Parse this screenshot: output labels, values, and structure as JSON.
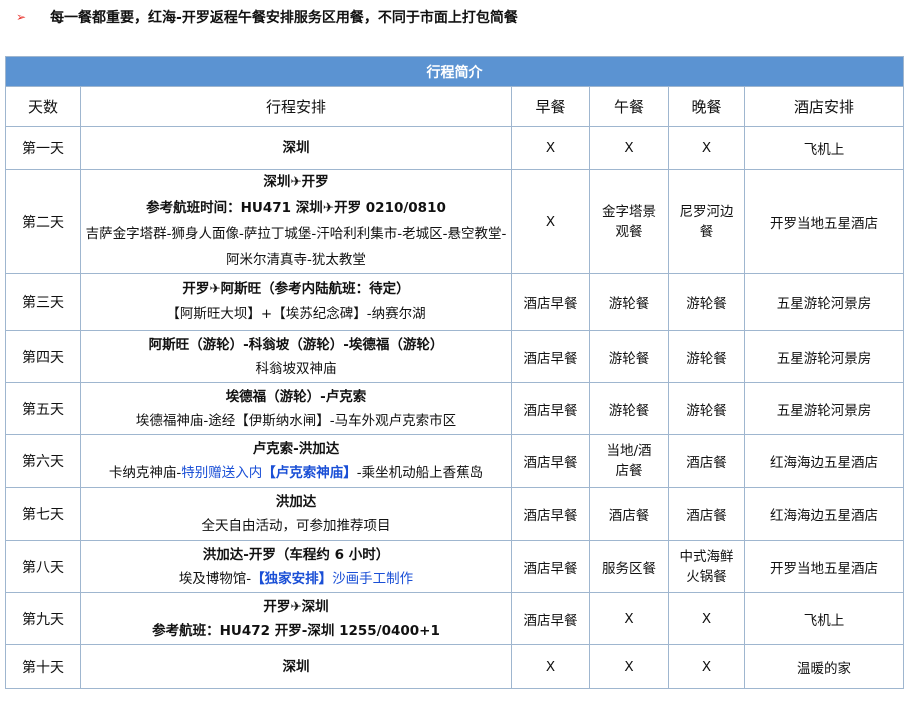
{
  "note": {
    "bullet": "➢",
    "text": "每一餐都重要，红海-开罗返程午餐安排服务区用餐，不同于市面上打包简餐"
  },
  "table": {
    "title": "行程简介",
    "headers": {
      "day": "天数",
      "schedule": "行程安排",
      "breakfast": "早餐",
      "lunch": "午餐",
      "dinner": "晚餐",
      "hotel": "酒店安排"
    },
    "rows": [
      {
        "day": "第一天",
        "title": "深圳",
        "ref": "",
        "detail_a": "",
        "detail_hl": "",
        "detail_b": "",
        "breakfast": "X",
        "lunch": "X",
        "dinner": "X",
        "hotel": "飞机上"
      },
      {
        "day": "第二天",
        "title": "深圳✈开罗",
        "ref": "参考航班时间：HU471 深圳✈开罗   0210/0810",
        "detail_a": "吉萨金字塔群-狮身人面像-萨拉丁城堡-汗哈利利集市-老城区-悬空教堂-阿米尔清真寺-犹太教堂",
        "detail_hl": "",
        "detail_b": "",
        "breakfast": "X",
        "lunch": "金字塔景观餐",
        "dinner": "尼罗河边餐",
        "hotel": "开罗当地五星酒店"
      },
      {
        "day": "第三天",
        "title": "开罗✈阿斯旺（参考内陆航班：待定）",
        "ref": "",
        "detail_a": "【阿斯旺大坝】+【埃苏纪念碑】-纳赛尔湖",
        "detail_hl": "",
        "detail_b": "",
        "breakfast": "酒店早餐",
        "lunch": "游轮餐",
        "dinner": "游轮餐",
        "hotel": "五星游轮河景房"
      },
      {
        "day": "第四天",
        "title": "阿斯旺（游轮）-科翁坡（游轮）-埃德福（游轮）",
        "ref": "",
        "detail_a": "科翁坡双神庙",
        "detail_hl": "",
        "detail_b": "",
        "breakfast": "酒店早餐",
        "lunch": "游轮餐",
        "dinner": "游轮餐",
        "hotel": "五星游轮河景房"
      },
      {
        "day": "第五天",
        "title": "埃德福（游轮）-卢克索",
        "ref": "",
        "detail_a": "埃德福神庙-途经【伊斯纳水闸】-马车外观卢克索市区",
        "detail_hl": "",
        "detail_b": "",
        "breakfast": "酒店早餐",
        "lunch": "游轮餐",
        "dinner": "游轮餐",
        "hotel": "五星游轮河景房"
      },
      {
        "day": "第六天",
        "title": "卢克索-洪加达",
        "ref": "",
        "detail_a": "卡纳克神庙-",
        "detail_hl_plain": "特别赠送入内",
        "detail_hl": "【卢克索神庙】",
        "detail_b": "-乘坐机动船上香蕉岛",
        "breakfast": "酒店早餐",
        "lunch": "当地/酒店餐",
        "dinner": "酒店餐",
        "hotel": "红海海边五星酒店"
      },
      {
        "day": "第七天",
        "title": "洪加达",
        "ref": "",
        "detail_a": "全天自由活动，可参加推荐项目",
        "detail_hl": "",
        "detail_b": "",
        "breakfast": "酒店早餐",
        "lunch": "酒店餐",
        "dinner": "酒店餐",
        "hotel": "红海海边五星酒店"
      },
      {
        "day": "第八天",
        "title": "洪加达-开罗（车程约 6 小时）",
        "ref": "",
        "detail_a": "埃及博物馆-",
        "detail_hl_plain": "",
        "detail_hl": "【独家安排】",
        "detail_b": "沙画手工制作",
        "breakfast": "酒店早餐",
        "lunch": "服务区餐",
        "dinner": "中式海鲜火锅餐",
        "hotel": "开罗当地五星酒店"
      },
      {
        "day": "第九天",
        "title": "开罗✈深圳",
        "ref": "参考航班：HU472 开罗-深圳 1255/0400+1",
        "detail_a": "",
        "detail_hl": "",
        "detail_b": "",
        "breakfast": "酒店早餐",
        "lunch": "X",
        "dinner": "X",
        "hotel": "飞机上"
      },
      {
        "day": "第十天",
        "title": "深圳",
        "ref": "",
        "detail_a": "",
        "detail_hl": "",
        "detail_b": "",
        "breakfast": "X",
        "lunch": "X",
        "dinner": "X",
        "hotel": "温暖的家"
      }
    ]
  }
}
